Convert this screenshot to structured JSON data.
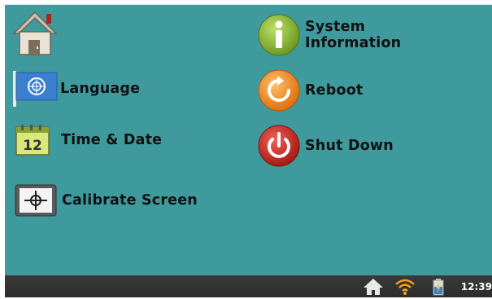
{
  "menu": {
    "home_label": "",
    "language_label": "Language",
    "time_date_label": "Time & Date",
    "calibrate_label": "Calibrate Screen",
    "system_info_label": "System\nInformation",
    "reboot_label": "Reboot",
    "shutdown_label": "Shut Down"
  },
  "calendar_day": "12",
  "taskbar": {
    "time": "12:39",
    "icons": [
      "home-icon",
      "wifi-icon",
      "battery-charging-icon"
    ]
  },
  "colors": {
    "background": "#3f9a9d",
    "taskbar": "#2f2f2f",
    "info_green": "#8ab838",
    "reboot_orange": "#f08a1c",
    "shutdown_red": "#c8281e"
  }
}
